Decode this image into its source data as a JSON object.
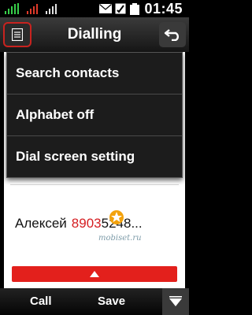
{
  "status": {
    "time": "01:45",
    "colors": {
      "signal1": "#38d04a",
      "signal2": "#e03a2a",
      "signal3": "#e1e1e1"
    },
    "icons": [
      "signal-icon",
      "secondary-signal-icon",
      "envelope-icon",
      "network-icon",
      "battery-icon"
    ]
  },
  "header": {
    "title": "Dialling",
    "menu_icon": "menu-list-icon",
    "back_icon": "back-arrow-icon"
  },
  "menu": {
    "items": [
      {
        "label": "Search contacts"
      },
      {
        "label": "Alphabet off"
      },
      {
        "label": "Dial screen setting"
      }
    ]
  },
  "entry": {
    "name": "Алексей",
    "number_highlight": "8903",
    "number_rest": "5248..."
  },
  "watermark": "mobiset.ru",
  "softkeys": {
    "left": "Call",
    "right": "Save",
    "more_icon": "down-triangle-icon"
  },
  "colors": {
    "accent": "#d51e22",
    "menu_bg": "#1c1c1c",
    "content_bg": "#ffffff"
  }
}
